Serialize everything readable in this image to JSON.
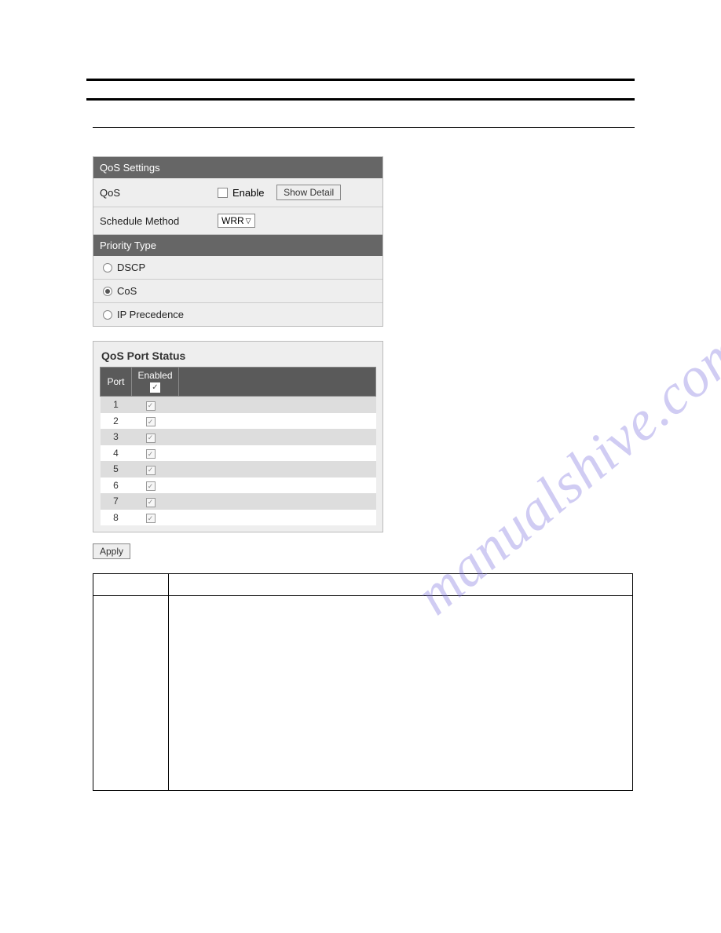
{
  "watermark": "manualshive.com",
  "qos_settings": {
    "header": "QoS Settings",
    "qos_label": "QoS",
    "enable_label": "Enable",
    "show_detail": "Show Detail",
    "schedule_label": "Schedule Method",
    "schedule_value": "WRR"
  },
  "priority_type": {
    "header": "Priority Type",
    "opt_dscp": "DSCP",
    "opt_cos": "CoS",
    "opt_ip": "IP Precedence"
  },
  "port_status": {
    "title": "QoS Port Status",
    "col_port": "Port",
    "col_enabled": "Enabled",
    "rows": [
      {
        "port": "1",
        "enabled": true
      },
      {
        "port": "2",
        "enabled": true
      },
      {
        "port": "3",
        "enabled": true
      },
      {
        "port": "4",
        "enabled": true
      },
      {
        "port": "5",
        "enabled": true
      },
      {
        "port": "6",
        "enabled": true
      },
      {
        "port": "7",
        "enabled": true
      },
      {
        "port": "8",
        "enabled": true
      }
    ]
  },
  "apply_label": "Apply"
}
